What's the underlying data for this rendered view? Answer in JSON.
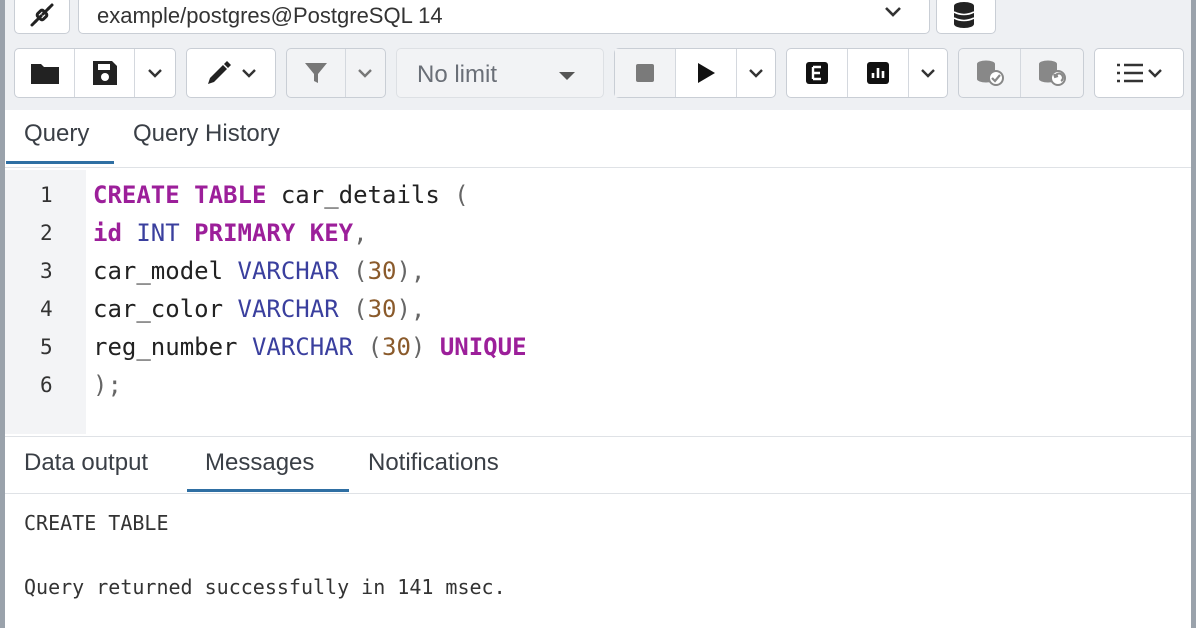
{
  "connection": {
    "value": "example/postgres@PostgreSQL 14"
  },
  "toolbar": {
    "icons": [
      "open-file-icon",
      "save-icon",
      "chevron-down-icon",
      "edit-pencil-icon",
      "filter-icon",
      "stop-icon",
      "play-icon",
      "explain-icon",
      "explain-analyze-icon",
      "commit-icon",
      "rollback-icon",
      "macros-icon"
    ],
    "limit_label": "No limit"
  },
  "query_tabs": {
    "active": "Query",
    "items": [
      "Query",
      "Query History"
    ]
  },
  "editor": {
    "line_numbers": [
      "1",
      "2",
      "3",
      "4",
      "5",
      "6"
    ],
    "lines": [
      "CREATE TABLE car_details (",
      "id INT PRIMARY KEY,",
      "car_model VARCHAR (30),",
      "car_color VARCHAR (30),",
      "reg_number VARCHAR (30) UNIQUE",
      ");"
    ]
  },
  "result_tabs": {
    "active": "Messages",
    "items": [
      "Data output",
      "Messages",
      "Notifications"
    ]
  },
  "messages": {
    "line1": "CREATE TABLE",
    "line2": "Query returned successfully in 141 msec."
  },
  "colors": {
    "accent": "#2f6fa3",
    "keyword": "#9c1f9a",
    "type": "#3a3f9e",
    "number": "#8a5a2b"
  }
}
